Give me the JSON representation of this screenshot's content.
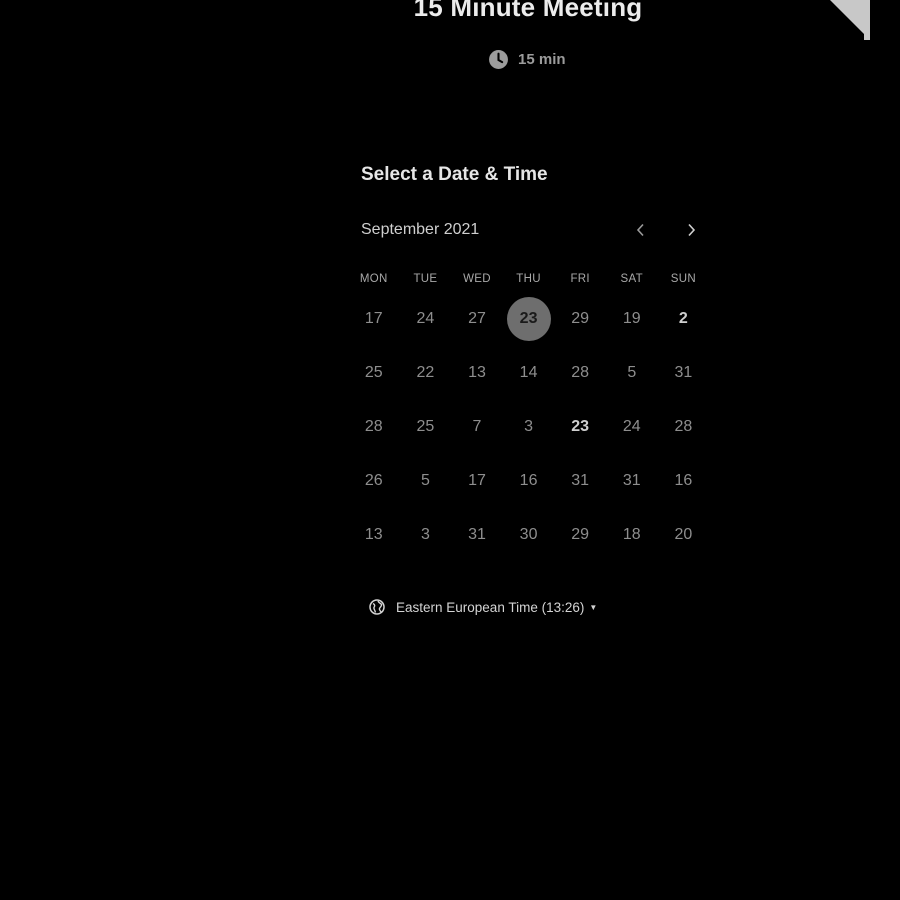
{
  "event": {
    "title": "15 Minute Meeting",
    "duration": "15 min"
  },
  "scheduler": {
    "section_title": "Select a Date & Time",
    "month": "September 2021",
    "weekdays": [
      "MON",
      "TUE",
      "WED",
      "THU",
      "FRI",
      "SAT",
      "SUN"
    ],
    "weeks": [
      [
        "17",
        "24",
        "27",
        "23",
        "29",
        "19",
        "2"
      ],
      [
        "25",
        "22",
        "13",
        "14",
        "28",
        "5",
        "31"
      ],
      [
        "28",
        "25",
        "7",
        "3",
        "23",
        "24",
        "28"
      ],
      [
        "26",
        "5",
        "17",
        "16",
        "31",
        "31",
        "16"
      ],
      [
        "13",
        "3",
        "31",
        "30",
        "29",
        "18",
        "20"
      ]
    ],
    "selected_day": "23"
  },
  "timezone": {
    "label": "Eastern European Time (13:26)"
  },
  "icons": {
    "duration": "clock-icon",
    "prev": "chevron-left-icon",
    "next": "chevron-right-icon",
    "timezone": "globe-icon",
    "dropdown": "caret-down-icon"
  },
  "colors": {
    "background": "#000000",
    "selected_day_bg": "#6e6e6e"
  }
}
